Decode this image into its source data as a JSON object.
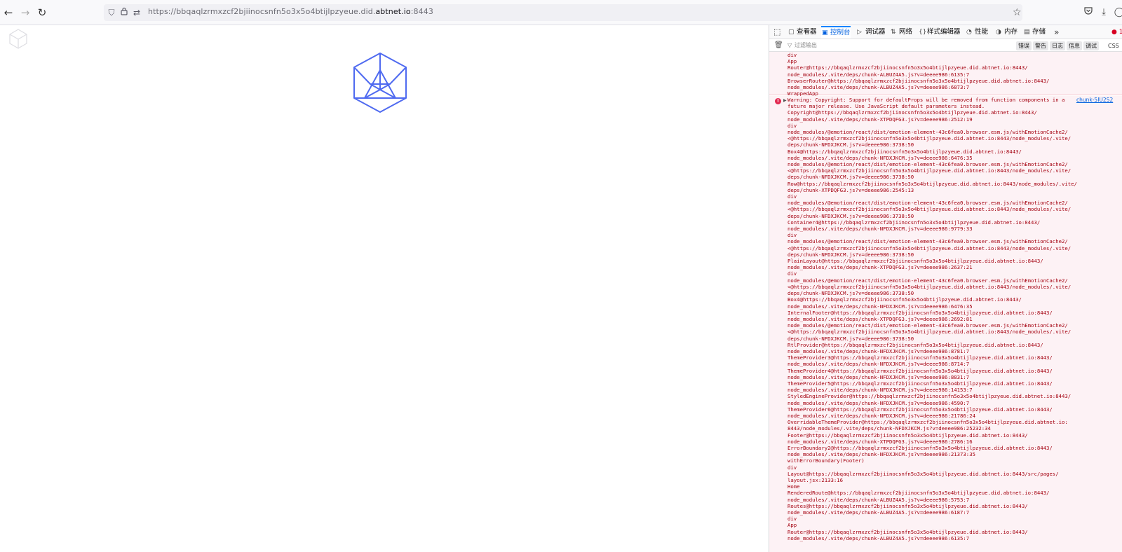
{
  "browser": {
    "url_prefix": "https://bbqaqlzrmxzcf2bjiinocsnfn5o3x5o4btijlpzyeue.did.",
    "url_host": "abtnet.io",
    "url_suffix": ":8443",
    "icons": {
      "back": "arrow-left-icon",
      "forward": "arrow-right-icon",
      "reload": "reload-icon",
      "bookmark": "star-icon"
    }
  },
  "devtools": {
    "tabs": [
      {
        "label": "查看器",
        "icon": "inspector-icon"
      },
      {
        "label": "控制台",
        "icon": "console-icon",
        "active": true
      },
      {
        "label": "调试器",
        "icon": "debugger-icon"
      },
      {
        "label": "网络",
        "icon": "network-icon"
      },
      {
        "label": "样式编辑器",
        "icon": "style-editor-icon"
      },
      {
        "label": "性能",
        "icon": "performance-icon"
      },
      {
        "label": "内存",
        "icon": "memory-icon"
      },
      {
        "label": "存储",
        "icon": "storage-icon"
      }
    ],
    "error_count": "1",
    "filter_placeholder": "过滤输出",
    "levels": [
      "错误",
      "警告",
      "日志",
      "信息",
      "调试"
    ],
    "css_label": "CSS",
    "accent": "#0060df",
    "error_color": "#a4000f"
  },
  "console": {
    "message1_lines": [
      "div",
      "App",
      "Router@https://bbqaqlzrmxzcf2bjiinocsnfn5o3x5o4btijlpzyeue.did.abtnet.io:8443/",
      "node_modules/.vite/deps/chunk-ALBUZ4A5.js?v=deeee986:6135:7",
      "BrowserRouter@https://bbqaqlzrmxzcf2bjiinocsnfn5o3x5o4btijlpzyeue.did.abtnet.io:8443/",
      "node_modules/.vite/deps/chunk-ALBUZ4A5.js?v=deeee986:6873:7",
      "WrappedApp"
    ],
    "message2_source": "chunk-5IU2S2",
    "message2_lines": [
      "Warning: Copyright: Support for defaultProps will be removed from function components in a",
      "future major release. Use JavaScript default parameters instead.",
      "Copyright@https://bbqaqlzrmxzcf2bjiinocsnfn5o3x5o4btijlpzyeue.did.abtnet.io:8443/",
      "node_modules/.vite/deps/chunk-XTPDQFG3.js?v=deeee986:2512:19",
      "div",
      "node_modules/@emotion/react/dist/emotion-element-43c6fea0.browser.esm.js/withEmotionCache2/",
      "<@https://bbqaqlzrmxzcf2bjiinocsnfn5o3x5o4btijlpzyeue.did.abtnet.io:8443/node_modules/.vite/",
      "deps/chunk-NFDXJKCM.js?v=deeee986:3738:50",
      "Box4@https://bbqaqlzrmxzcf2bjiinocsnfn5o3x5o4btijlpzyeue.did.abtnet.io:8443/",
      "node_modules/.vite/deps/chunk-NFDXJKCM.js?v=deeee986:6476:35",
      "node_modules/@emotion/react/dist/emotion-element-43c6fea0.browser.esm.js/withEmotionCache2/",
      "<@https://bbqaqlzrmxzcf2bjiinocsnfn5o3x5o4btijlpzyeue.did.abtnet.io:8443/node_modules/.vite/",
      "deps/chunk-NFDXJKCM.js?v=deeee986:3738:50",
      "Row@https://bbqaqlzrmxzcf2bjiinocsnfn5o3x5o4btijlpzyeue.did.abtnet.io:8443/node_modules/.vite/",
      "deps/chunk-XTPDQFG3.js?v=deeee986:2545:13",
      "div",
      "node_modules/@emotion/react/dist/emotion-element-43c6fea0.browser.esm.js/withEmotionCache2/",
      "<@https://bbqaqlzrmxzcf2bjiinocsnfn5o3x5o4btijlpzyeue.did.abtnet.io:8443/node_modules/.vite/",
      "deps/chunk-NFDXJKCM.js?v=deeee986:3738:50",
      "Container4@https://bbqaqlzrmxzcf2bjiinocsnfn5o3x5o4btijlpzyeue.did.abtnet.io:8443/",
      "node_modules/.vite/deps/chunk-NFDXJKCM.js?v=deeee986:9779:33",
      "div",
      "node_modules/@emotion/react/dist/emotion-element-43c6fea0.browser.esm.js/withEmotionCache2/",
      "<@https://bbqaqlzrmxzcf2bjiinocsnfn5o3x5o4btijlpzyeue.did.abtnet.io:8443/node_modules/.vite/",
      "deps/chunk-NFDXJKCM.js?v=deeee986:3738:50",
      "PlainLayout@https://bbqaqlzrmxzcf2bjiinocsnfn5o3x5o4btijlpzyeue.did.abtnet.io:8443/",
      "node_modules/.vite/deps/chunk-XTPDQFG3.js?v=deeee986:2637:21",
      "div",
      "node_modules/@emotion/react/dist/emotion-element-43c6fea0.browser.esm.js/withEmotionCache2/",
      "<@https://bbqaqlzrmxzcf2bjiinocsnfn5o3x5o4btijlpzyeue.did.abtnet.io:8443/node_modules/.vite/",
      "deps/chunk-NFDXJKCM.js?v=deeee986:3738:50",
      "Box4@https://bbqaqlzrmxzcf2bjiinocsnfn5o3x5o4btijlpzyeue.did.abtnet.io:8443/",
      "node_modules/.vite/deps/chunk-NFDXJKCM.js?v=deeee986:6476:35",
      "InternalFooter@https://bbqaqlzrmxzcf2bjiinocsnfn5o3x5o4btijlpzyeue.did.abtnet.io:8443/",
      "node_modules/.vite/deps/chunk-XTPDQFG3.js?v=deeee986:2692:81",
      "node_modules/@emotion/react/dist/emotion-element-43c6fea0.browser.esm.js/withEmotionCache2/",
      "<@https://bbqaqlzrmxzcf2bjiinocsnfn5o3x5o4btijlpzyeue.did.abtnet.io:8443/node_modules/.vite/",
      "deps/chunk-NFDXJKCM.js?v=deeee986:3738:50",
      "RtlProvider@https://bbqaqlzrmxzcf2bjiinocsnfn5o3x5o4btijlpzyeue.did.abtnet.io:8443/",
      "node_modules/.vite/deps/chunk-NFDXJKCM.js?v=deeee986:8781:7",
      "ThemeProvider3@https://bbqaqlzrmxzcf2bjiinocsnfn5o3x5o4btijlpzyeue.did.abtnet.io:8443/",
      "node_modules/.vite/deps/chunk-NFDXJKCM.js?v=deeee986:8714:7",
      "ThemeProvider4@https://bbqaqlzrmxzcf2bjiinocsnfn5o3x5o4btijlpzyeue.did.abtnet.io:8443/",
      "node_modules/.vite/deps/chunk-NFDXJKCM.js?v=deeee986:8831:7",
      "ThemeProvider5@https://bbqaqlzrmxzcf2bjiinocsnfn5o3x5o4btijlpzyeue.did.abtnet.io:8443/",
      "node_modules/.vite/deps/chunk-NFDXJKCM.js?v=deeee986:14153:7",
      "StyledEngineProvider@https://bbqaqlzrmxzcf2bjiinocsnfn5o3x5o4btijlpzyeue.did.abtnet.io:8443/",
      "node_modules/.vite/deps/chunk-NFDXJKCM.js?v=deeee986:4590:7",
      "ThemeProvider6@https://bbqaqlzrmxzcf2bjiinocsnfn5o3x5o4btijlpzyeue.did.abtnet.io:8443/",
      "node_modules/.vite/deps/chunk-NFDXJKCM.js?v=deeee986:21786:24",
      "OverridableThemeProvider@https://bbqaqlzrmxzcf2bjiinocsnfn5o3x5o4btijlpzyeue.did.abtnet.io:",
      "8443/node_modules/.vite/deps/chunk-NFDXJKCM.js?v=deeee986:25232:34",
      "Footer@https://bbqaqlzrmxzcf2bjiinocsnfn5o3x5o4btijlpzyeue.did.abtnet.io:8443/",
      "node_modules/.vite/deps/chunk-XTPDQFG3.js?v=deeee986:2786:16",
      "ErrorBoundary2@https://bbqaqlzrmxzcf2bjiinocsnfn5o3x5o4btijlpzyeue.did.abtnet.io:8443/",
      "node_modules/.vite/deps/chunk-NFDXJKCM.js?v=deeee986:21373:35",
      "withErrorBoundary(Footer)",
      "div",
      "Layout@https://bbqaqlzrmxzcf2bjiinocsnfn5o3x5o4btijlpzyeue.did.abtnet.io:8443/src/pages/",
      "layout.jsx:2133:16",
      "Home",
      "RenderedRoute@https://bbqaqlzrmxzcf2bjiinocsnfn5o3x5o4btijlpzyeue.did.abtnet.io:8443/",
      "node_modules/.vite/deps/chunk-ALBUZ4A5.js?v=deeee986:5753:7",
      "Routes@https://bbqaqlzrmxzcf2bjiinocsnfn5o3x5o4btijlpzyeue.did.abtnet.io:8443/",
      "node_modules/.vite/deps/chunk-ALBUZ4A5.js?v=deeee986:6187:7",
      "div",
      "App",
      "Router@https://bbqaqlzrmxzcf2bjiinocsnfn5o3x5o4btijlpzyeue.did.abtnet.io:8443/",
      "node_modules/.vite/deps/chunk-ALBUZ4A5.js?v=deeee986:6135:7"
    ]
  }
}
